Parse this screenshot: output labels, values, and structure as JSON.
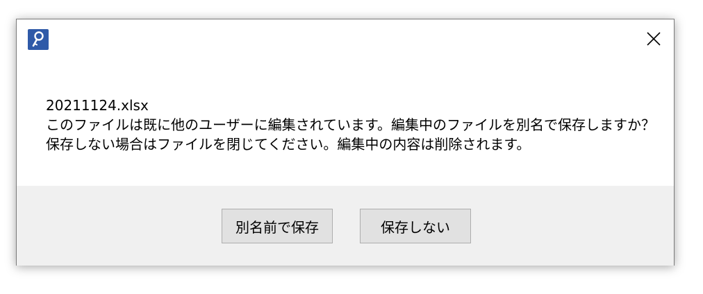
{
  "dialog": {
    "message": {
      "filename": "20211124.xlsx",
      "line1": "このファイルは既に他のユーザーに編集されています。編集中のファイルを別名で保存しますか？",
      "line2": "保存しない場合はファイルを閉じてください。編集中の内容は削除されます。"
    },
    "buttons": {
      "save_as": "別名前で保存",
      "dont_save": "保存しない"
    }
  },
  "icons": {
    "app": "app-key-icon",
    "close": "close-icon"
  },
  "colors": {
    "app_icon_bg": "#2f5aa8",
    "footer_bg": "#f0f0f0",
    "button_bg": "#e1e1e1",
    "button_border": "#adadad"
  }
}
